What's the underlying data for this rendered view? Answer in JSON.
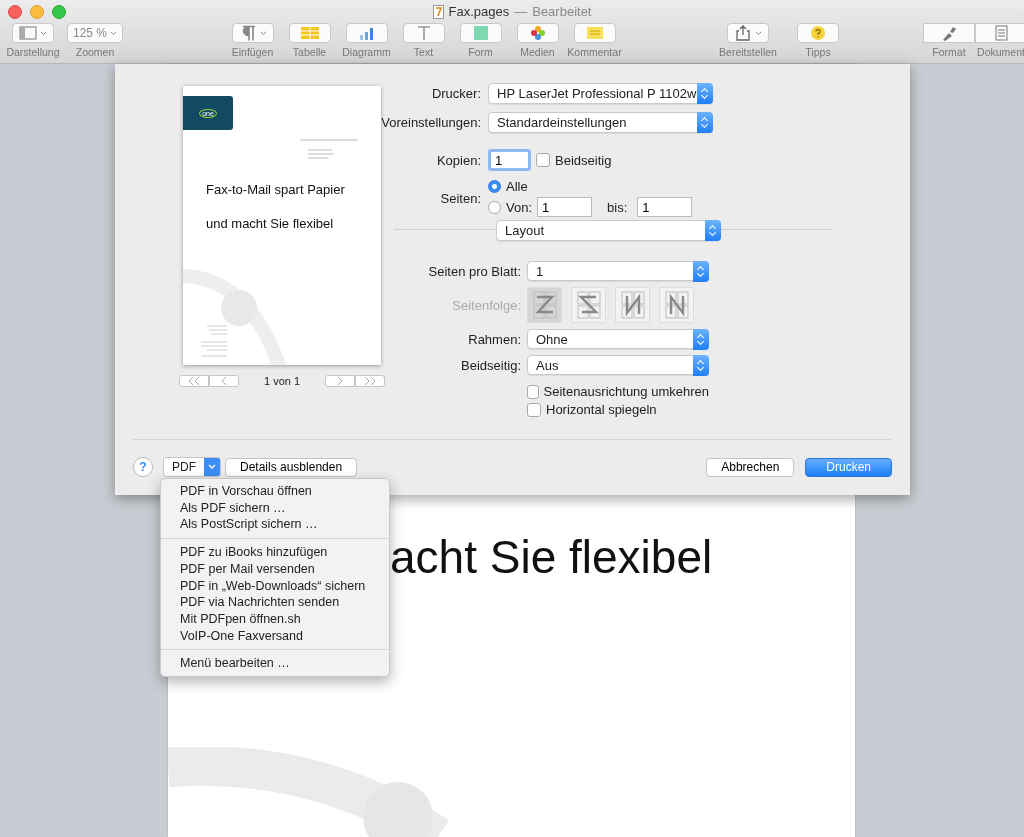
{
  "window": {
    "title": "Fax.pages",
    "separator": "—",
    "status": "Bearbeitet"
  },
  "toolbar": [
    {
      "items": [
        {
          "kind": "view",
          "label": "Darstellung"
        },
        {
          "kind": "zoom",
          "label": "Zoomen",
          "value": "125 %"
        }
      ]
    },
    {
      "items": [
        {
          "kind": "insert",
          "label": "Einfügen"
        },
        {
          "kind": "table",
          "label": "Tabelle"
        },
        {
          "kind": "chart",
          "label": "Diagramm"
        },
        {
          "kind": "text",
          "label": "Text"
        },
        {
          "kind": "shape",
          "label": "Form"
        },
        {
          "kind": "media",
          "label": "Medien"
        },
        {
          "kind": "comment",
          "label": "Kommentar"
        }
      ]
    },
    {
      "items": [
        {
          "kind": "share",
          "label": "Bereitstellen"
        },
        {
          "kind": "tips",
          "label": "Tipps"
        }
      ]
    },
    {
      "items": [
        {
          "kind": "format",
          "label": "Format"
        },
        {
          "kind": "document",
          "label": "Dokument"
        }
      ]
    }
  ],
  "document": {
    "visible_text": "acht Sie flexibel"
  },
  "print_dialog": {
    "preview": {
      "logo_text": "one",
      "headline_lines": [
        "Fax-to-Mail spart Papier",
        "und macht Sie flexibel"
      ],
      "page_indicator": "1 von 1"
    },
    "printer": {
      "label": "Drucker:",
      "value": "HP LaserJet Professional P 1102w"
    },
    "presets": {
      "label": "Voreinstellungen:",
      "value": "Standardeinstellungen"
    },
    "copies": {
      "label": "Kopien:",
      "value": "1",
      "two_sided": {
        "label": "Beidseitig",
        "checked": false
      }
    },
    "pages": {
      "label": "Seiten:",
      "options": [
        {
          "label": "Alle",
          "selected": true
        },
        {
          "label": "Von:",
          "selected": false
        }
      ],
      "from": "1",
      "to_label": "bis:",
      "to": "1"
    },
    "section": {
      "value": "Layout"
    },
    "pages_per_sheet": {
      "label": "Seiten pro Blatt:",
      "value": "1"
    },
    "page_order": {
      "label": "Seitenfolge:",
      "disabled": true,
      "options": [
        {
          "kind": "z",
          "selected": true
        },
        {
          "kind": "s",
          "selected": false
        },
        {
          "kind": "n-rev",
          "selected": false
        },
        {
          "kind": "n",
          "selected": false
        }
      ]
    },
    "border": {
      "label": "Rahmen:",
      "value": "Ohne"
    },
    "duplex": {
      "label": "Beidseitig:",
      "value": "Aus"
    },
    "checkboxes": [
      {
        "label": "Seitenausrichtung umkehren",
        "checked": false
      },
      {
        "label": "Horizontal spiegeln",
        "checked": false
      }
    ],
    "footer": {
      "help": "?",
      "pdf": "PDF",
      "details": "Details ausblenden",
      "cancel": "Abbrechen",
      "print": "Drucken"
    }
  },
  "pdf_menu": {
    "sections": [
      [
        "PDF in Vorschau öffnen",
        "Als PDF sichern …",
        "Als PostScript sichern …"
      ],
      [
        "PDF zu iBooks hinzufügen",
        "PDF per Mail versenden",
        "PDF in „Web-Downloads“ sichern",
        "PDF via Nachrichten senden",
        "Mit PDFpen öffnen.sh",
        "VoIP-One Faxversand"
      ],
      [
        "Menü bearbeiten …"
      ]
    ]
  }
}
